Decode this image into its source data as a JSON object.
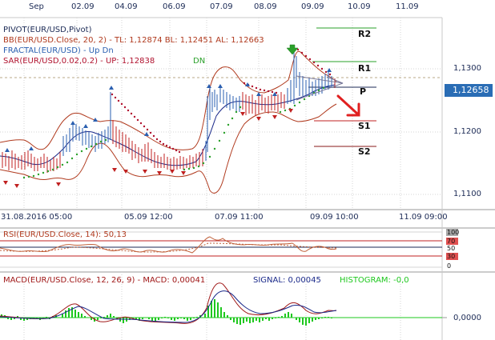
{
  "top_dates": [
    "Sep",
    "02.09",
    "04.09",
    "06.09",
    "07.09",
    "08.09",
    "09.09",
    "10.09",
    "11.09"
  ],
  "main_panel": {
    "indicators": [
      {
        "id": "pivot",
        "text": "PIVOT(EUR/USD,Pivot)",
        "color": "#1b2a55"
      },
      {
        "id": "bb",
        "text": "BB(EUR/USD.Close, 20, 2) - TL: 1,12874  BL: 1,12451   AL: 1,12663",
        "color": "#b03a1e"
      },
      {
        "id": "fractal",
        "text": "FRACTAL(EUR/USD) - Up  Dn",
        "color": "#2a5fb0"
      },
      {
        "id": "sar_prefix",
        "text": "SAR(EUR/USD,0.02,0.2) - UP: 1,12838",
        "color": "#b0122e"
      },
      {
        "id": "sar_dn",
        "text": "DN",
        "color": "#2aa02a"
      }
    ],
    "pivot_levels": [
      "R2",
      "R1",
      "P",
      "S1",
      "S2"
    ],
    "price_axis": [
      "1,1300",
      "1,1200",
      "1,1100"
    ],
    "current_price": "1,12658"
  },
  "bottom_dates": [
    "31.08.2016 05:00",
    "05.09 12:00",
    "07.09 11:00",
    "09.09 10:00",
    "11.09 09:00"
  ],
  "rsi_panel": {
    "label": "RSI(EUR/USD.Close, 14): 50,13",
    "levels": [
      "100",
      "70",
      "50",
      "30",
      "0"
    ]
  },
  "macd_panel": {
    "label_prefix": "MACD(EUR/USD.Close, 12, 26, 9) - MACD: 0,00041",
    "signal": "SIGNAL: 0,00045",
    "histogram": "HISTOGRAM: -0,0",
    "zero": "0,0000"
  },
  "colors": {
    "up_candle": "#2a5fb0",
    "down_candle": "#c02020",
    "bollinger": "#b03a1e",
    "sar_up": "#b0122e",
    "sar_dn": "#2aa02a",
    "ema": "#1b2a8a",
    "macd_line": "#a01818",
    "signal_line": "#1b2a8a",
    "histogram": "#1ec81e",
    "arrow": "#e02020",
    "current_price_bg": "#2a6db5"
  }
}
